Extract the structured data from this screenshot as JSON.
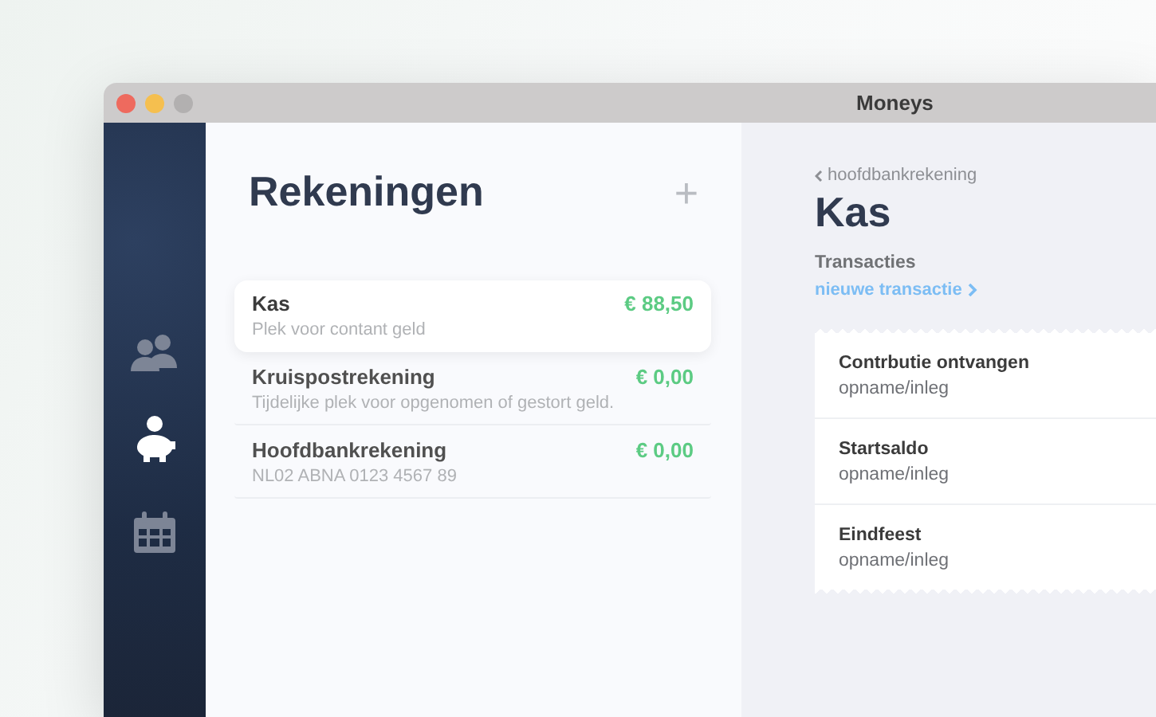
{
  "window": {
    "title": "Moneys"
  },
  "sidebar": {
    "items": [
      {
        "kind": "people",
        "selected": false
      },
      {
        "kind": "piggy",
        "selected": true
      },
      {
        "kind": "calendar",
        "selected": false
      }
    ]
  },
  "accounts": {
    "title": "Rekeningen",
    "add": "+",
    "items": [
      {
        "name": "Kas",
        "amount": "€ 88,50",
        "description": "Plek voor contant geld",
        "selected": true
      },
      {
        "name": "Kruispostrekening",
        "amount": "€ 0,00",
        "description": "Tijdelijke plek voor opgenomen of gestort geld.",
        "selected": false
      },
      {
        "name": "Hoofdbankrekening",
        "amount": "€ 0,00",
        "description": "NL02 ABNA 0123 4567 89",
        "selected": false
      }
    ]
  },
  "detail": {
    "back": "hoofdbankrekening",
    "title": "Kas",
    "section": "Transacties",
    "new_link": "nieuwe transactie",
    "transactions": [
      {
        "name": "Contrbutie ontvangen",
        "type": "opname/inleg"
      },
      {
        "name": "Startsaldo",
        "type": "opname/inleg"
      },
      {
        "name": "Eindfeest",
        "type": "opname/inleg"
      }
    ]
  }
}
